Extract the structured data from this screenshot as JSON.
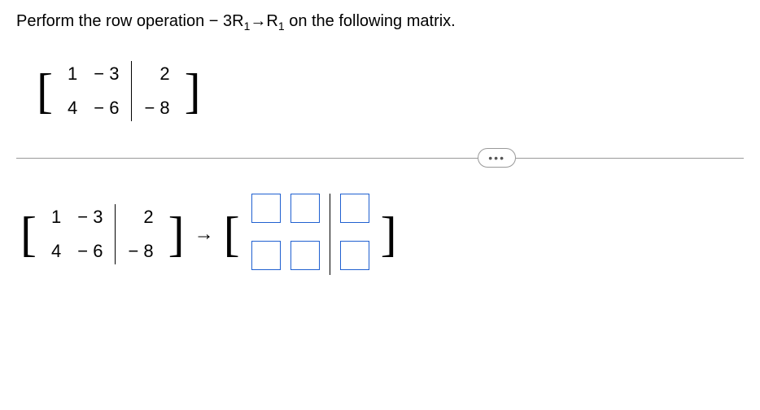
{
  "instruction": {
    "prefix": "Perform the row operation  ",
    "operation_left": "− 3R",
    "sub1": "1",
    "arrow": "→",
    "operation_right": "R",
    "sub2": "1",
    "suffix": " on the following matrix."
  },
  "matrix": {
    "r1c1": "1",
    "r1c2": "− 3",
    "r1c3": "2",
    "r2c1": "4",
    "r2c2": "− 6",
    "r2c3": "− 8"
  },
  "dots": "•••",
  "arrow_symbol": "→"
}
